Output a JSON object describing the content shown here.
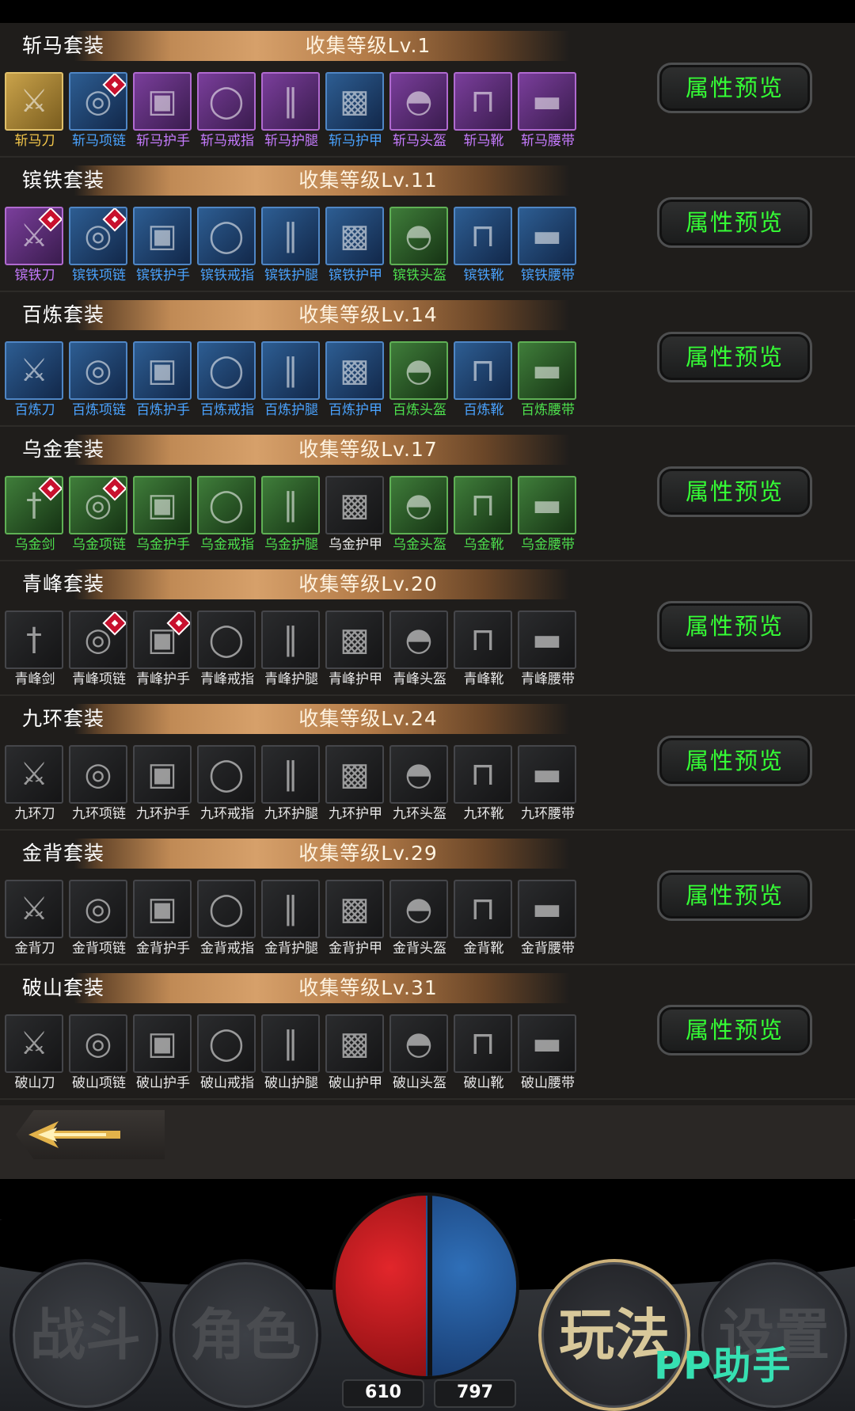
{
  "sets": [
    {
      "name": "斩马套装",
      "level": "收集等级Lv.1",
      "button": "属性预览",
      "items": [
        {
          "label": "斩马刀",
          "quality": "gold",
          "icon": "blade-icon",
          "gem": false
        },
        {
          "label": "斩马项链",
          "quality": "blue",
          "icon": "necklace-icon",
          "gem": true
        },
        {
          "label": "斩马护手",
          "quality": "purple",
          "icon": "bracer-icon",
          "gem": false
        },
        {
          "label": "斩马戒指",
          "quality": "purple",
          "icon": "ring-icon",
          "gem": false
        },
        {
          "label": "斩马护腿",
          "quality": "purple",
          "icon": "leggings-icon",
          "gem": false
        },
        {
          "label": "斩马护甲",
          "quality": "blue",
          "icon": "armor-icon",
          "gem": false
        },
        {
          "label": "斩马头盔",
          "quality": "purple",
          "icon": "helmet-icon",
          "gem": false
        },
        {
          "label": "斩马靴",
          "quality": "purple",
          "icon": "boots-icon",
          "gem": false
        },
        {
          "label": "斩马腰带",
          "quality": "purple",
          "icon": "belt-icon",
          "gem": false
        }
      ]
    },
    {
      "name": "镔铁套装",
      "level": "收集等级Lv.11",
      "button": "属性预览",
      "items": [
        {
          "label": "镔铁刀",
          "quality": "purple",
          "icon": "blade-icon",
          "gem": true
        },
        {
          "label": "镔铁项链",
          "quality": "blue",
          "icon": "necklace-icon",
          "gem": true
        },
        {
          "label": "镔铁护手",
          "quality": "blue",
          "icon": "bracer-icon",
          "gem": false
        },
        {
          "label": "镔铁戒指",
          "quality": "blue",
          "icon": "ring-icon",
          "gem": false
        },
        {
          "label": "镔铁护腿",
          "quality": "blue",
          "icon": "leggings-icon",
          "gem": false
        },
        {
          "label": "镔铁护甲",
          "quality": "blue",
          "icon": "armor-icon",
          "gem": false
        },
        {
          "label": "镔铁头盔",
          "quality": "green",
          "icon": "helmet-icon",
          "gem": false
        },
        {
          "label": "镔铁靴",
          "quality": "blue",
          "icon": "boots-icon",
          "gem": false
        },
        {
          "label": "镔铁腰带",
          "quality": "blue",
          "icon": "belt-icon",
          "gem": false
        }
      ]
    },
    {
      "name": "百炼套装",
      "level": "收集等级Lv.14",
      "button": "属性预览",
      "items": [
        {
          "label": "百炼刀",
          "quality": "blue",
          "icon": "blade-icon",
          "gem": false
        },
        {
          "label": "百炼项链",
          "quality": "blue",
          "icon": "necklace-icon",
          "gem": false
        },
        {
          "label": "百炼护手",
          "quality": "blue",
          "icon": "bracer-icon",
          "gem": false
        },
        {
          "label": "百炼戒指",
          "quality": "blue",
          "icon": "ring-icon",
          "gem": false
        },
        {
          "label": "百炼护腿",
          "quality": "blue",
          "icon": "leggings-icon",
          "gem": false
        },
        {
          "label": "百炼护甲",
          "quality": "blue",
          "icon": "armor-icon",
          "gem": false
        },
        {
          "label": "百炼头盔",
          "quality": "green",
          "icon": "helmet-icon",
          "gem": false
        },
        {
          "label": "百炼靴",
          "quality": "blue",
          "icon": "boots-icon",
          "gem": false
        },
        {
          "label": "百炼腰带",
          "quality": "green",
          "icon": "belt-icon",
          "gem": false
        }
      ]
    },
    {
      "name": "乌金套装",
      "level": "收集等级Lv.17",
      "button": "属性预览",
      "items": [
        {
          "label": "乌金剑",
          "quality": "green",
          "icon": "sword-icon",
          "gem": true
        },
        {
          "label": "乌金项链",
          "quality": "green",
          "icon": "necklace-icon",
          "gem": true
        },
        {
          "label": "乌金护手",
          "quality": "green",
          "icon": "bracer-icon",
          "gem": false
        },
        {
          "label": "乌金戒指",
          "quality": "green",
          "icon": "ring-icon",
          "gem": false
        },
        {
          "label": "乌金护腿",
          "quality": "green",
          "icon": "leggings-icon",
          "gem": false
        },
        {
          "label": "乌金护甲",
          "quality": "dark",
          "icon": "armor-icon",
          "gem": false
        },
        {
          "label": "乌金头盔",
          "quality": "green",
          "icon": "helmet-icon",
          "gem": false
        },
        {
          "label": "乌金靴",
          "quality": "green",
          "icon": "boots-icon",
          "gem": false
        },
        {
          "label": "乌金腰带",
          "quality": "green",
          "icon": "belt-icon",
          "gem": false
        }
      ]
    },
    {
      "name": "青峰套装",
      "level": "收集等级Lv.20",
      "button": "属性预览",
      "items": [
        {
          "label": "青峰剑",
          "quality": "dark",
          "icon": "sword-icon",
          "gem": false
        },
        {
          "label": "青峰项链",
          "quality": "dark",
          "icon": "necklace-icon",
          "gem": true
        },
        {
          "label": "青峰护手",
          "quality": "dark",
          "icon": "bracer-icon",
          "gem": true
        },
        {
          "label": "青峰戒指",
          "quality": "dark",
          "icon": "ring-icon",
          "gem": false
        },
        {
          "label": "青峰护腿",
          "quality": "dark",
          "icon": "leggings-icon",
          "gem": false
        },
        {
          "label": "青峰护甲",
          "quality": "dark",
          "icon": "armor-icon",
          "gem": false
        },
        {
          "label": "青峰头盔",
          "quality": "dark",
          "icon": "helmet-icon",
          "gem": false
        },
        {
          "label": "青峰靴",
          "quality": "dark",
          "icon": "boots-icon",
          "gem": false
        },
        {
          "label": "青峰腰带",
          "quality": "dark",
          "icon": "belt-icon",
          "gem": false
        }
      ]
    },
    {
      "name": "九环套装",
      "level": "收集等级Lv.24",
      "button": "属性预览",
      "items": [
        {
          "label": "九环刀",
          "quality": "dark",
          "icon": "blade-icon",
          "gem": false
        },
        {
          "label": "九环项链",
          "quality": "dark",
          "icon": "necklace-icon",
          "gem": false
        },
        {
          "label": "九环护手",
          "quality": "dark",
          "icon": "bracer-icon",
          "gem": false
        },
        {
          "label": "九环戒指",
          "quality": "dark",
          "icon": "ring-icon",
          "gem": false
        },
        {
          "label": "九环护腿",
          "quality": "dark",
          "icon": "leggings-icon",
          "gem": false
        },
        {
          "label": "九环护甲",
          "quality": "dark",
          "icon": "armor-icon",
          "gem": false
        },
        {
          "label": "九环头盔",
          "quality": "dark",
          "icon": "helmet-icon",
          "gem": false
        },
        {
          "label": "九环靴",
          "quality": "dark",
          "icon": "boots-icon",
          "gem": false
        },
        {
          "label": "九环腰带",
          "quality": "dark",
          "icon": "belt-icon",
          "gem": false
        }
      ]
    },
    {
      "name": "金背套装",
      "level": "收集等级Lv.29",
      "button": "属性预览",
      "items": [
        {
          "label": "金背刀",
          "quality": "dark",
          "icon": "blade-icon",
          "gem": false
        },
        {
          "label": "金背项链",
          "quality": "dark",
          "icon": "necklace-icon",
          "gem": false
        },
        {
          "label": "金背护手",
          "quality": "dark",
          "icon": "bracer-icon",
          "gem": false
        },
        {
          "label": "金背戒指",
          "quality": "dark",
          "icon": "ring-icon",
          "gem": false
        },
        {
          "label": "金背护腿",
          "quality": "dark",
          "icon": "leggings-icon",
          "gem": false
        },
        {
          "label": "金背护甲",
          "quality": "dark",
          "icon": "armor-icon",
          "gem": false
        },
        {
          "label": "金背头盔",
          "quality": "dark",
          "icon": "helmet-icon",
          "gem": false
        },
        {
          "label": "金背靴",
          "quality": "dark",
          "icon": "boots-icon",
          "gem": false
        },
        {
          "label": "金背腰带",
          "quality": "dark",
          "icon": "belt-icon",
          "gem": false
        }
      ]
    },
    {
      "name": "破山套装",
      "level": "收集等级Lv.31",
      "button": "属性预览",
      "items": [
        {
          "label": "破山刀",
          "quality": "dark",
          "icon": "blade-icon",
          "gem": false
        },
        {
          "label": "破山项链",
          "quality": "dark",
          "icon": "necklace-icon",
          "gem": false
        },
        {
          "label": "破山护手",
          "quality": "dark",
          "icon": "bracer-icon",
          "gem": false
        },
        {
          "label": "破山戒指",
          "quality": "dark",
          "icon": "ring-icon",
          "gem": false
        },
        {
          "label": "破山护腿",
          "quality": "dark",
          "icon": "leggings-icon",
          "gem": false
        },
        {
          "label": "破山护甲",
          "quality": "dark",
          "icon": "armor-icon",
          "gem": false
        },
        {
          "label": "破山头盔",
          "quality": "dark",
          "icon": "helmet-icon",
          "gem": false
        },
        {
          "label": "破山靴",
          "quality": "dark",
          "icon": "boots-icon",
          "gem": false
        },
        {
          "label": "破山腰带",
          "quality": "dark",
          "icon": "belt-icon",
          "gem": false
        }
      ]
    }
  ],
  "nav": {
    "battle": "战斗",
    "character": "角色",
    "gameplay": "玩法",
    "settings": "设置"
  },
  "stats": {
    "hp": "610",
    "mp": "797"
  },
  "watermark": "PP助手",
  "colors": {
    "button_text": "#35ff35",
    "hp": "#d41f24",
    "mp": "#2a62a8"
  }
}
